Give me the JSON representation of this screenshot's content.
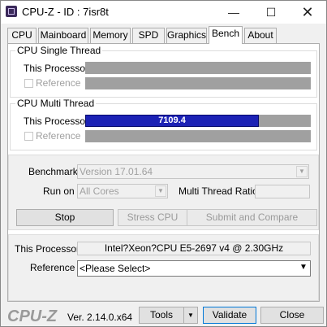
{
  "window": {
    "title": "CPU-Z - ID : 7isr8t",
    "minimize_glyph": "—",
    "maximize_glyph": "☐",
    "close_glyph": "✕"
  },
  "tabs": [
    {
      "label": "CPU"
    },
    {
      "label": "Mainboard"
    },
    {
      "label": "Memory"
    },
    {
      "label": "SPD"
    },
    {
      "label": "Graphics"
    },
    {
      "label": "Bench"
    },
    {
      "label": "About"
    }
  ],
  "single_thread": {
    "title": "CPU Single Thread",
    "this_processor_label": "This Processor",
    "reference_label": "Reference",
    "this_processor_value": "",
    "this_processor_fraction": 0
  },
  "multi_thread": {
    "title": "CPU Multi Thread",
    "this_processor_label": "This Processor",
    "reference_label": "Reference",
    "this_processor_value": "7109.4",
    "this_processor_fraction": 0.77
  },
  "controls": {
    "benchmark_label": "Benchmark",
    "benchmark_value": "Version 17.01.64",
    "run_on_label": "Run on",
    "run_on_value": "All Cores",
    "multi_thread_ratio_label": "Multi Thread Ratio",
    "multi_thread_ratio_value": "",
    "stop_label": "Stop",
    "stress_cpu_label": "Stress CPU",
    "submit_label": "Submit and Compare"
  },
  "processor_info": {
    "this_processor_label": "This Processor",
    "this_processor_value": "Intel?Xeon?CPU E5-2697 v4 @ 2.30GHz",
    "reference_label": "Reference",
    "reference_value": "<Please Select>"
  },
  "footer": {
    "brand": "CPU-Z",
    "version": "Ver. 2.14.0.x64",
    "tools_label": "Tools",
    "validate_label": "Validate",
    "close_label": "Close"
  },
  "colors": {
    "bar_fill": "#1c22b5",
    "bar_background": "#a0a0a0"
  }
}
